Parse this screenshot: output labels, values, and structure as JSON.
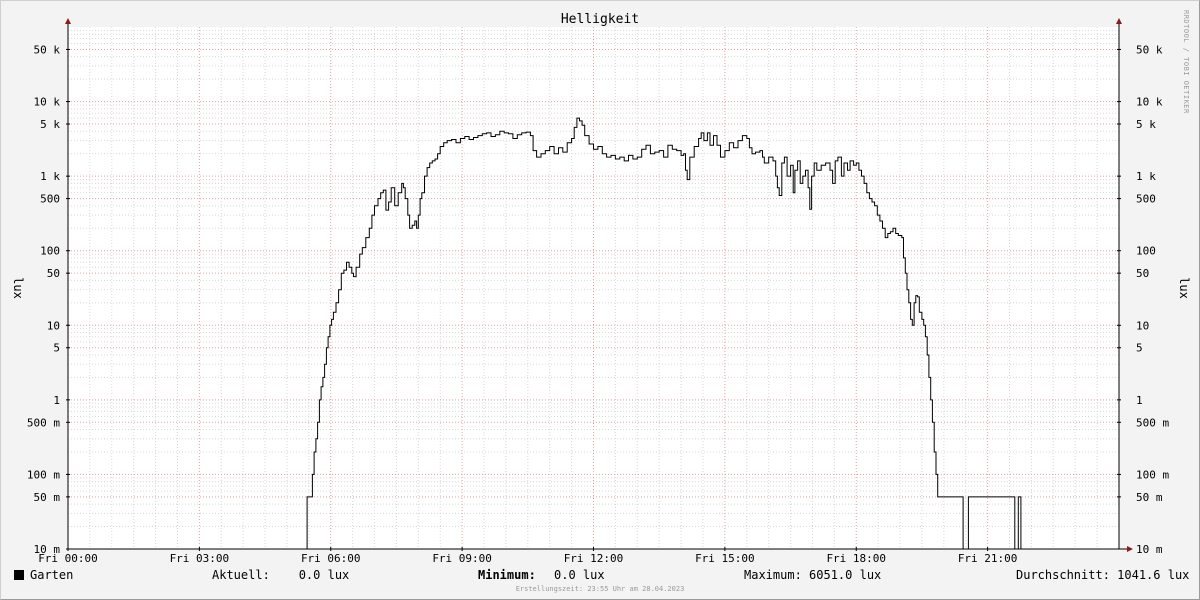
{
  "colors": {
    "line": "#000000",
    "background": "#ffffff",
    "canvas": "#f3f3f3",
    "grid_major": "#e3a0a0",
    "grid_minor": "#d8d8d8",
    "axis": "#000000",
    "arrow": "#8b1a1a"
  },
  "watermark": "RRDTOOL / TOBI OETIKER",
  "legend": {
    "series": "Garten",
    "current": "Aktuell:    0.0 lux",
    "minimum_label": "Minimum:",
    "minimum_value": "0.0 lux",
    "maximum": "Maximum: 6051.0 lux",
    "average": "Durchschnitt: 1041.6 lux"
  },
  "footer": "Erstellungszeit: 23:55 Uhr am 28.04.2023",
  "chart_data": {
    "type": "line",
    "title": "Helligkeit",
    "xlabel": "",
    "ylabel": "lux",
    "y_scale": "log",
    "ylim": [
      0.01,
      100000
    ],
    "xlim_hours": [
      0,
      24
    ],
    "grid": true,
    "legend_position": "bottom",
    "x_ticks": [
      {
        "h": 0,
        "label": "Fri 00:00"
      },
      {
        "h": 3,
        "label": "Fri 03:00"
      },
      {
        "h": 6,
        "label": "Fri 06:00"
      },
      {
        "h": 9,
        "label": "Fri 09:00"
      },
      {
        "h": 12,
        "label": "Fri 12:00"
      },
      {
        "h": 15,
        "label": "Fri 15:00"
      },
      {
        "h": 18,
        "label": "Fri 18:00"
      },
      {
        "h": 21,
        "label": "Fri 21:00"
      }
    ],
    "y_ticks": [
      {
        "v": 50000,
        "label": "50 k"
      },
      {
        "v": 10000,
        "label": "10 k"
      },
      {
        "v": 5000,
        "label": "5 k"
      },
      {
        "v": 1000,
        "label": "1 k"
      },
      {
        "v": 500,
        "label": "500"
      },
      {
        "v": 100,
        "label": "100"
      },
      {
        "v": 50,
        "label": "50"
      },
      {
        "v": 10,
        "label": "10"
      },
      {
        "v": 5,
        "label": "5"
      },
      {
        "v": 1,
        "label": "1"
      },
      {
        "v": 0.5,
        "label": "500 m"
      },
      {
        "v": 0.1,
        "label": "100 m"
      },
      {
        "v": 0.05,
        "label": "50 m"
      },
      {
        "v": 0.01,
        "label": "10 m"
      }
    ],
    "series": [
      {
        "name": "Garten",
        "points": [
          [
            0.0,
            0.01
          ],
          [
            5.42,
            0.01
          ],
          [
            5.46,
            0.05
          ],
          [
            5.55,
            0.05
          ],
          [
            5.58,
            0.1
          ],
          [
            5.62,
            0.2
          ],
          [
            5.66,
            0.3
          ],
          [
            5.7,
            0.5
          ],
          [
            5.74,
            1
          ],
          [
            5.78,
            1.5
          ],
          [
            5.82,
            2
          ],
          [
            5.86,
            3
          ],
          [
            5.9,
            5
          ],
          [
            5.94,
            7
          ],
          [
            5.98,
            10
          ],
          [
            6.02,
            12
          ],
          [
            6.06,
            15
          ],
          [
            6.12,
            20
          ],
          [
            6.18,
            30
          ],
          [
            6.24,
            50
          ],
          [
            6.3,
            55
          ],
          [
            6.36,
            70
          ],
          [
            6.42,
            60
          ],
          [
            6.48,
            50
          ],
          [
            6.52,
            45
          ],
          [
            6.58,
            60
          ],
          [
            6.66,
            90
          ],
          [
            6.72,
            110
          ],
          [
            6.8,
            150
          ],
          [
            6.88,
            200
          ],
          [
            6.94,
            300
          ],
          [
            7.0,
            400
          ],
          [
            7.08,
            500
          ],
          [
            7.14,
            600
          ],
          [
            7.2,
            650
          ],
          [
            7.26,
            350
          ],
          [
            7.32,
            450
          ],
          [
            7.38,
            700
          ],
          [
            7.46,
            400
          ],
          [
            7.54,
            600
          ],
          [
            7.62,
            800
          ],
          [
            7.66,
            700
          ],
          [
            7.7,
            500
          ],
          [
            7.76,
            300
          ],
          [
            7.8,
            200
          ],
          [
            7.86,
            220
          ],
          [
            7.92,
            250
          ],
          [
            7.96,
            200
          ],
          [
            8.0,
            300
          ],
          [
            8.04,
            500
          ],
          [
            8.08,
            600
          ],
          [
            8.14,
            1000
          ],
          [
            8.2,
            1300
          ],
          [
            8.26,
            1500
          ],
          [
            8.32,
            1600
          ],
          [
            8.38,
            1700
          ],
          [
            8.44,
            2000
          ],
          [
            8.5,
            2500
          ],
          [
            8.58,
            2800
          ],
          [
            8.66,
            3000
          ],
          [
            8.76,
            3100
          ],
          [
            8.86,
            2800
          ],
          [
            8.96,
            3200
          ],
          [
            9.06,
            3400
          ],
          [
            9.16,
            3100
          ],
          [
            9.26,
            3300
          ],
          [
            9.36,
            3500
          ],
          [
            9.46,
            3700
          ],
          [
            9.56,
            3800
          ],
          [
            9.66,
            3400
          ],
          [
            9.76,
            3600
          ],
          [
            9.86,
            4000
          ],
          [
            9.96,
            3800
          ],
          [
            10.06,
            3700
          ],
          [
            10.16,
            3200
          ],
          [
            10.26,
            3600
          ],
          [
            10.36,
            3800
          ],
          [
            10.46,
            3900
          ],
          [
            10.56,
            3500
          ],
          [
            10.62,
            2200
          ],
          [
            10.7,
            1800
          ],
          [
            10.8,
            2000
          ],
          [
            10.9,
            2200
          ],
          [
            11.0,
            2500
          ],
          [
            11.1,
            2000
          ],
          [
            11.2,
            2400
          ],
          [
            11.3,
            2100
          ],
          [
            11.4,
            2800
          ],
          [
            11.5,
            3200
          ],
          [
            11.56,
            4500
          ],
          [
            11.62,
            6000
          ],
          [
            11.68,
            5500
          ],
          [
            11.74,
            4800
          ],
          [
            11.8,
            3500
          ],
          [
            11.9,
            2700
          ],
          [
            12.0,
            2300
          ],
          [
            12.1,
            2500
          ],
          [
            12.2,
            2000
          ],
          [
            12.3,
            1800
          ],
          [
            12.4,
            1900
          ],
          [
            12.5,
            1700
          ],
          [
            12.6,
            1800
          ],
          [
            12.7,
            1600
          ],
          [
            12.8,
            1900
          ],
          [
            12.9,
            1700
          ],
          [
            13.0,
            1800
          ],
          [
            13.1,
            2300
          ],
          [
            13.2,
            2600
          ],
          [
            13.3,
            2000
          ],
          [
            13.4,
            2100
          ],
          [
            13.5,
            2200
          ],
          [
            13.6,
            1800
          ],
          [
            13.7,
            2600
          ],
          [
            13.8,
            2300
          ],
          [
            13.9,
            2200
          ],
          [
            14.0,
            1900
          ],
          [
            14.06,
            2000
          ],
          [
            14.1,
            1200
          ],
          [
            14.14,
            900
          ],
          [
            14.2,
            1800
          ],
          [
            14.3,
            2500
          ],
          [
            14.4,
            3200
          ],
          [
            14.46,
            3800
          ],
          [
            14.52,
            3000
          ],
          [
            14.6,
            3800
          ],
          [
            14.66,
            2600
          ],
          [
            14.74,
            3500
          ],
          [
            14.82,
            2600
          ],
          [
            14.9,
            1800
          ],
          [
            15.0,
            2200
          ],
          [
            15.1,
            2800
          ],
          [
            15.2,
            2400
          ],
          [
            15.3,
            3000
          ],
          [
            15.4,
            3500
          ],
          [
            15.5,
            3200
          ],
          [
            15.56,
            2400
          ],
          [
            15.62,
            2000
          ],
          [
            15.7,
            2100
          ],
          [
            15.8,
            2200
          ],
          [
            15.86,
            1800
          ],
          [
            15.9,
            1500
          ],
          [
            16.0,
            1800
          ],
          [
            16.1,
            1600
          ],
          [
            16.16,
            1000
          ],
          [
            16.2,
            700
          ],
          [
            16.24,
            550
          ],
          [
            16.3,
            1500
          ],
          [
            16.36,
            1800
          ],
          [
            16.42,
            1000
          ],
          [
            16.5,
            1400
          ],
          [
            16.56,
            600
          ],
          [
            16.6,
            1200
          ],
          [
            16.66,
            1600
          ],
          [
            16.72,
            800
          ],
          [
            16.78,
            1000
          ],
          [
            16.84,
            1200
          ],
          [
            16.9,
            700
          ],
          [
            16.94,
            360
          ],
          [
            16.98,
            1000
          ],
          [
            17.04,
            1500
          ],
          [
            17.1,
            1200
          ],
          [
            17.2,
            1400
          ],
          [
            17.3,
            1500
          ],
          [
            17.4,
            1200
          ],
          [
            17.46,
            800
          ],
          [
            17.52,
            1600
          ],
          [
            17.58,
            1800
          ],
          [
            17.66,
            1000
          ],
          [
            17.72,
            1500
          ],
          [
            17.8,
            1200
          ],
          [
            17.86,
            1600
          ],
          [
            17.94,
            1400
          ],
          [
            18.0,
            1500
          ],
          [
            18.06,
            1200
          ],
          [
            18.12,
            1000
          ],
          [
            18.18,
            800
          ],
          [
            18.24,
            600
          ],
          [
            18.3,
            500
          ],
          [
            18.36,
            450
          ],
          [
            18.42,
            400
          ],
          [
            18.48,
            300
          ],
          [
            18.54,
            250
          ],
          [
            18.6,
            200
          ],
          [
            18.66,
            150
          ],
          [
            18.72,
            170
          ],
          [
            18.78,
            180
          ],
          [
            18.84,
            200
          ],
          [
            18.9,
            170
          ],
          [
            18.96,
            160
          ],
          [
            19.04,
            150
          ],
          [
            19.08,
            80
          ],
          [
            19.12,
            50
          ],
          [
            19.16,
            30
          ],
          [
            19.2,
            20
          ],
          [
            19.24,
            12
          ],
          [
            19.28,
            10
          ],
          [
            19.32,
            20
          ],
          [
            19.36,
            25
          ],
          [
            19.4,
            24
          ],
          [
            19.44,
            15
          ],
          [
            19.5,
            12
          ],
          [
            19.54,
            10
          ],
          [
            19.58,
            7
          ],
          [
            19.62,
            4
          ],
          [
            19.66,
            2
          ],
          [
            19.7,
            1
          ],
          [
            19.74,
            0.5
          ],
          [
            19.78,
            0.2
          ],
          [
            19.82,
            0.1
          ],
          [
            19.86,
            0.05
          ],
          [
            20.4,
            0.05
          ],
          [
            20.44,
            0.01
          ],
          [
            20.52,
            0.01
          ],
          [
            20.56,
            0.05
          ],
          [
            21.6,
            0.05
          ],
          [
            21.62,
            0.01
          ],
          [
            21.68,
            0.01
          ],
          [
            21.7,
            0.05
          ],
          [
            21.74,
            0.05
          ],
          [
            21.76,
            0.01
          ],
          [
            21.82,
            0.01
          ]
        ]
      }
    ]
  }
}
